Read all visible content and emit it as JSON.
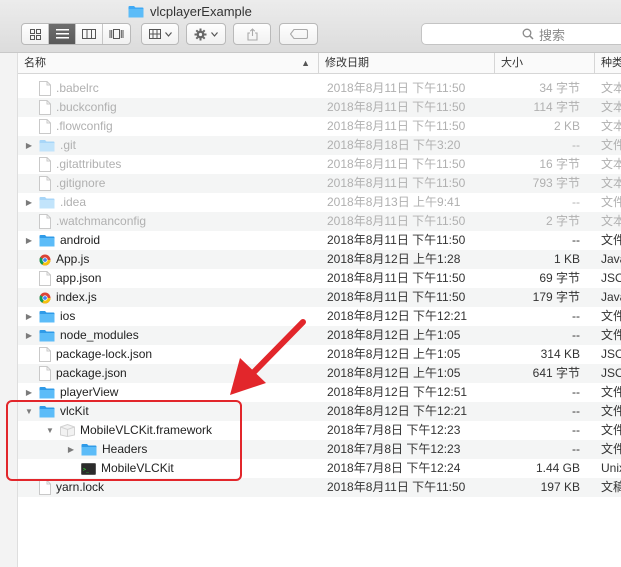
{
  "window": {
    "title": "vlcplayerExample"
  },
  "toolbar": {
    "view_buttons": [
      "icon-view-icon",
      "list-view-icon",
      "column-view-icon",
      "cover-flow-icon"
    ],
    "arrange_icon": "arrange-grid-icon",
    "action_icon": "gear-icon",
    "share_icon": "share-icon",
    "tag_icon": "tag-icon",
    "search_placeholder": "搜索"
  },
  "columns": {
    "name": "名称",
    "date": "修改日期",
    "size": "大小",
    "kind": "种类"
  },
  "files": [
    {
      "name": ".babelrc",
      "date": "2018年8月11日 下午11:50",
      "size": "34 字节",
      "kind": "文本",
      "type": "doc",
      "indent": 0,
      "disclosure": "",
      "hidden": true
    },
    {
      "name": ".buckconfig",
      "date": "2018年8月11日 下午11:50",
      "size": "114 字节",
      "kind": "文本",
      "type": "doc",
      "indent": 0,
      "disclosure": "",
      "hidden": true
    },
    {
      "name": ".flowconfig",
      "date": "2018年8月11日 下午11:50",
      "size": "2 KB",
      "kind": "文本",
      "type": "doc",
      "indent": 0,
      "disclosure": "",
      "hidden": true
    },
    {
      "name": ".git",
      "date": "2018年8月18日 下午3:20",
      "size": "--",
      "kind": "文件",
      "type": "folder-light",
      "indent": 0,
      "disclosure": "closed",
      "hidden": true
    },
    {
      "name": ".gitattributes",
      "date": "2018年8月11日 下午11:50",
      "size": "16 字节",
      "kind": "文本",
      "type": "doc",
      "indent": 0,
      "disclosure": "",
      "hidden": true
    },
    {
      "name": ".gitignore",
      "date": "2018年8月11日 下午11:50",
      "size": "793 字节",
      "kind": "文本",
      "type": "doc",
      "indent": 0,
      "disclosure": "",
      "hidden": true
    },
    {
      "name": ".idea",
      "date": "2018年8月13日 上午9:41",
      "size": "--",
      "kind": "文件",
      "type": "folder-light",
      "indent": 0,
      "disclosure": "closed",
      "hidden": true
    },
    {
      "name": ".watchmanconfig",
      "date": "2018年8月11日 下午11:50",
      "size": "2 字节",
      "kind": "文本",
      "type": "doc",
      "indent": 0,
      "disclosure": "",
      "hidden": true
    },
    {
      "name": "android",
      "date": "2018年8月11日 下午11:50",
      "size": "--",
      "kind": "文件",
      "type": "folder",
      "indent": 0,
      "disclosure": "closed",
      "hidden": false
    },
    {
      "name": "App.js",
      "date": "2018年8月12日 上午1:28",
      "size": "1 KB",
      "kind": "Java",
      "type": "chrome",
      "indent": 0,
      "disclosure": "",
      "hidden": false
    },
    {
      "name": "app.json",
      "date": "2018年8月11日 下午11:50",
      "size": "69 字节",
      "kind": "JSO",
      "type": "doc",
      "indent": 0,
      "disclosure": "",
      "hidden": false
    },
    {
      "name": "index.js",
      "date": "2018年8月11日 下午11:50",
      "size": "179 字节",
      "kind": "Java",
      "type": "chrome",
      "indent": 0,
      "disclosure": "",
      "hidden": false
    },
    {
      "name": "ios",
      "date": "2018年8月12日 下午12:21",
      "size": "--",
      "kind": "文件",
      "type": "folder",
      "indent": 0,
      "disclosure": "closed",
      "hidden": false
    },
    {
      "name": "node_modules",
      "date": "2018年8月12日 上午1:05",
      "size": "--",
      "kind": "文件",
      "type": "folder",
      "indent": 0,
      "disclosure": "closed",
      "hidden": false
    },
    {
      "name": "package-lock.json",
      "date": "2018年8月12日 上午1:05",
      "size": "314 KB",
      "kind": "JSO",
      "type": "doc",
      "indent": 0,
      "disclosure": "",
      "hidden": false
    },
    {
      "name": "package.json",
      "date": "2018年8月12日 上午1:05",
      "size": "641 字节",
      "kind": "JSO",
      "type": "doc",
      "indent": 0,
      "disclosure": "",
      "hidden": false
    },
    {
      "name": "playerView",
      "date": "2018年8月12日 下午12:51",
      "size": "--",
      "kind": "文件",
      "type": "folder",
      "indent": 0,
      "disclosure": "closed",
      "hidden": false
    },
    {
      "name": "vlcKit",
      "date": "2018年8月12日 下午12:21",
      "size": "--",
      "kind": "文件",
      "type": "folder",
      "indent": 0,
      "disclosure": "open",
      "hidden": false
    },
    {
      "name": "MobileVLCKit.framework",
      "date": "2018年7月8日 下午12:23",
      "size": "--",
      "kind": "文件",
      "type": "framework",
      "indent": 1,
      "disclosure": "open",
      "hidden": false
    },
    {
      "name": "Headers",
      "date": "2018年7月8日 下午12:23",
      "size": "--",
      "kind": "文件",
      "type": "folder",
      "indent": 2,
      "disclosure": "closed",
      "hidden": false
    },
    {
      "name": "MobileVLCKit",
      "date": "2018年7月8日 下午12:24",
      "size": "1.44 GB",
      "kind": "Unix",
      "type": "terminal",
      "indent": 2,
      "disclosure": "",
      "hidden": false
    },
    {
      "name": "yarn.lock",
      "date": "2018年8月11日 下午11:50",
      "size": "197 KB",
      "kind": "文稿",
      "type": "doc",
      "indent": 0,
      "disclosure": "",
      "hidden": false
    }
  ],
  "colors": {
    "folder": "#3fa9f5",
    "annotation": "#e2262b"
  }
}
